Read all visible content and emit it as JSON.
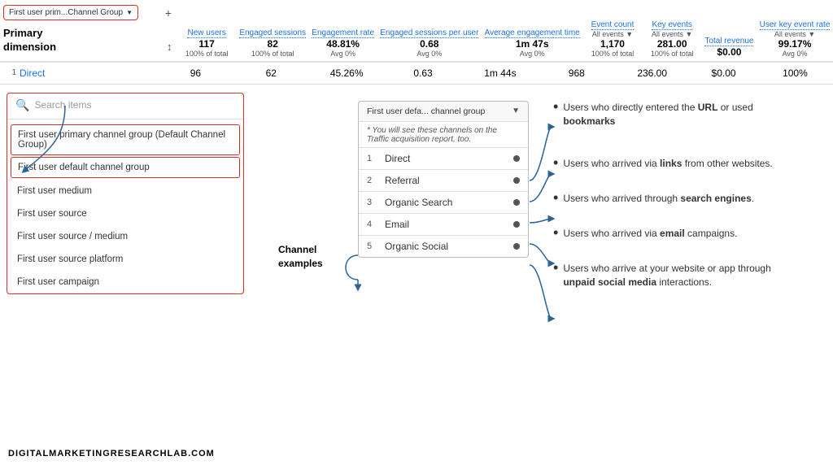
{
  "table": {
    "dim_pill_label": "First user prim...Channel Group",
    "primary_dimension_label": "Primary\ndimension",
    "metrics": [
      {
        "name": "New users",
        "sub": "",
        "total": "117",
        "pct": "100% of total"
      },
      {
        "name": "Engaged sessions",
        "sub": "",
        "total": "82",
        "pct": "100% of total"
      },
      {
        "name": "Engagement rate",
        "sub": "",
        "total": "48.81%",
        "pct": "Avg 0%"
      },
      {
        "name": "Engaged sessions per user",
        "sub": "",
        "total": "0.68",
        "pct": "Avg 0%"
      },
      {
        "name": "Average engagement time",
        "sub": "",
        "total": "1m 47s",
        "pct": "Avg 0%"
      },
      {
        "name": "Event count",
        "sub": "All events ▼",
        "total": "1,170",
        "pct": "100% of total"
      },
      {
        "name": "Key events",
        "sub": "All events ▼",
        "total": "281.00",
        "pct": "100% of total"
      },
      {
        "name": "Total revenue",
        "sub": "",
        "total": "$0.00",
        "pct": ""
      },
      {
        "name": "User key event rate",
        "sub": "All events ▼",
        "total": "99.17%",
        "pct": "Avg 0%"
      }
    ],
    "rows": [
      {
        "num": "1",
        "dim": "Direct",
        "values": [
          "96",
          "62",
          "45.26%",
          "0.63",
          "1m 44s",
          "968",
          "236.00",
          "$0.00",
          "100%"
        ]
      }
    ]
  },
  "dropdown": {
    "search_placeholder": "Search items",
    "items": [
      {
        "label": "First user primary channel group (Default Channel Group)",
        "highlighted": true
      },
      {
        "label": "First user default channel group",
        "highlighted": true
      },
      {
        "label": "First user medium",
        "highlighted": false
      },
      {
        "label": "First user source",
        "highlighted": false
      },
      {
        "label": "First user source / medium",
        "highlighted": false
      },
      {
        "label": "First user source platform",
        "highlighted": false
      },
      {
        "label": "First user campaign",
        "highlighted": false
      }
    ]
  },
  "channel_table": {
    "header": "First user defa... channel group",
    "note": "* You will see these channels on the Traffic acquisition report, too.",
    "rows": [
      {
        "num": "1",
        "name": "Direct"
      },
      {
        "num": "2",
        "name": "Referral"
      },
      {
        "num": "3",
        "name": "Organic Search"
      },
      {
        "num": "4",
        "name": "Email"
      },
      {
        "num": "5",
        "name": "Organic Social"
      }
    ]
  },
  "channel_examples_label": "Channel\nexamples",
  "annotations": [
    {
      "text_parts": [
        "Users who directly entered the ",
        "URL",
        " or used ",
        "bookmarks"
      ]
    },
    {
      "text_parts": [
        "Users who arrived via ",
        "links",
        " from other websites."
      ]
    },
    {
      "text_parts": [
        "Users who arrived through ",
        "search engines",
        "."
      ]
    },
    {
      "text_parts": [
        "Users who arrived via ",
        "email",
        " campaigns."
      ]
    },
    {
      "text_parts": [
        "Users who arrive at your website or app through ",
        "unpaid social media",
        " interactions."
      ]
    }
  ],
  "footer": {
    "label": "DIGITALMARKETINGRESEARCHLAB.COM"
  }
}
